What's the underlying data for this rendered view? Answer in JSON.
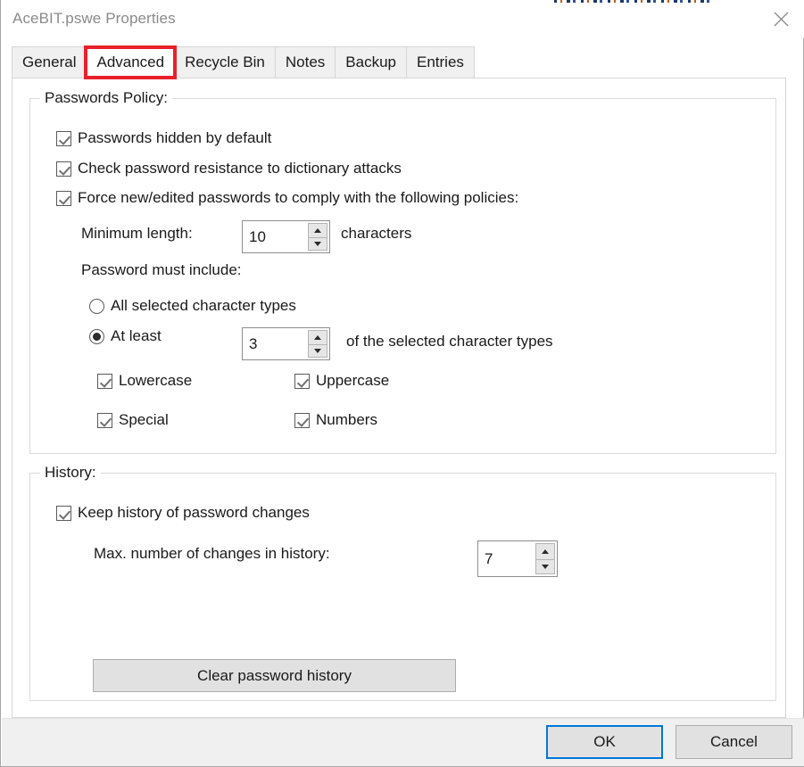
{
  "window": {
    "title": "AceBIT.pswe Properties",
    "close_icon": "close-icon"
  },
  "tabs": [
    {
      "label": "General",
      "selected": false
    },
    {
      "label": "Advanced",
      "selected": true
    },
    {
      "label": "Recycle Bin",
      "selected": false
    },
    {
      "label": "Notes",
      "selected": false
    },
    {
      "label": "Backup",
      "selected": false
    },
    {
      "label": "Entries",
      "selected": false
    }
  ],
  "annotation": {
    "target": "Advanced",
    "color": "#e8212b"
  },
  "passwords_policy": {
    "group_title": "Passwords Policy:",
    "hidden_by_default": {
      "label": "Passwords hidden by default",
      "checked": true
    },
    "dictionary_check": {
      "label": "Check password resistance to dictionary attacks",
      "checked": true
    },
    "force_policies": {
      "label": "Force new/edited passwords to comply with the following policies:",
      "checked": true
    },
    "minimum_length": {
      "label": "Minimum length:",
      "value": "10",
      "suffix": "characters"
    },
    "must_include_label": "Password must include:",
    "mode_all": {
      "label": "All selected character types",
      "selected": false
    },
    "mode_at_least": {
      "label": "At least",
      "selected": true,
      "value": "3",
      "suffix": "of the selected character types"
    },
    "char_types": [
      {
        "label": "Lowercase",
        "checked": true
      },
      {
        "label": "Uppercase",
        "checked": true
      },
      {
        "label": "Special",
        "checked": true
      },
      {
        "label": "Numbers",
        "checked": true
      }
    ]
  },
  "history": {
    "group_title": "History:",
    "keep_history": {
      "label": "Keep history of password changes",
      "checked": true
    },
    "max_changes": {
      "label": "Max. number of changes in history:",
      "value": "7"
    },
    "clear_button": "Clear password history"
  },
  "footer": {
    "ok_label": "OK",
    "cancel_label": "Cancel"
  }
}
